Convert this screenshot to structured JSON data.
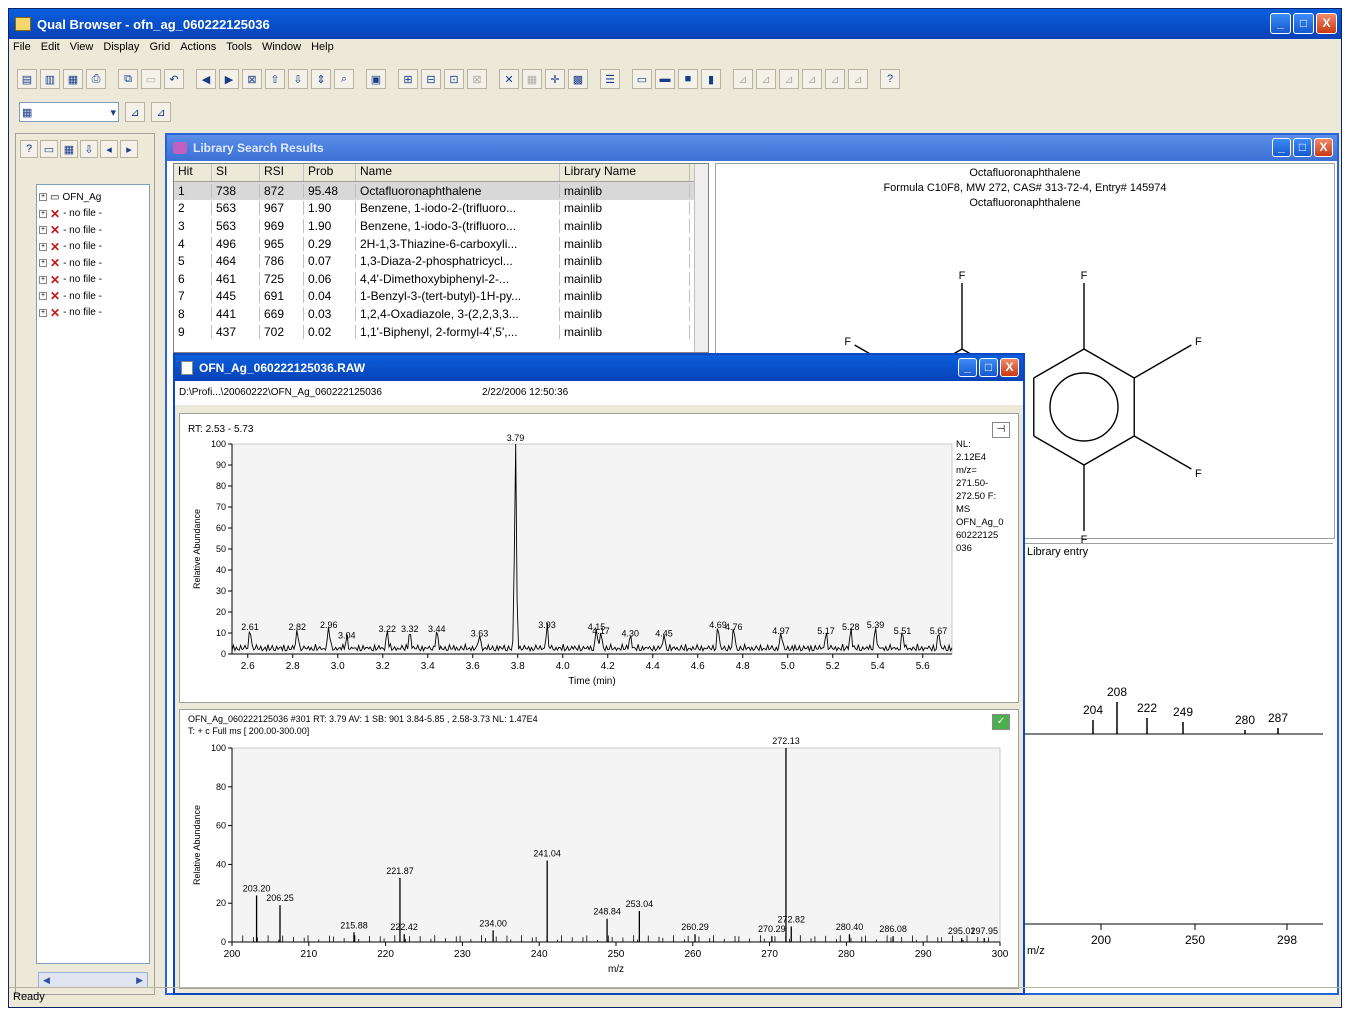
{
  "app": {
    "title": "Qual Browser - ofn_ag_060222125036",
    "minimize": "_",
    "maximize": "□",
    "close": "X",
    "status": "Ready"
  },
  "menu": [
    "File",
    "Edit",
    "View",
    "Display",
    "Grid",
    "Actions",
    "Tools",
    "Window",
    "Help"
  ],
  "toolbar2": {
    "combo_value": ""
  },
  "tree": {
    "items": [
      {
        "label": "OFN_Ag",
        "icon": "document-icon"
      },
      {
        "label": "- no file -",
        "icon": "error-x-icon"
      },
      {
        "label": "- no file -",
        "icon": "error-x-icon"
      },
      {
        "label": "- no file -",
        "icon": "error-x-icon"
      },
      {
        "label": "- no file -",
        "icon": "error-x-icon"
      },
      {
        "label": "- no file -",
        "icon": "error-x-icon"
      },
      {
        "label": "- no file -",
        "icon": "error-x-icon"
      },
      {
        "label": "- no file -",
        "icon": "error-x-icon"
      }
    ]
  },
  "library": {
    "title": "Library Search Results",
    "columns": [
      "Hit",
      "SI",
      "RSI",
      "Prob",
      "Name",
      "Library Name"
    ],
    "rows": [
      [
        "1",
        "738",
        "872",
        "95.48",
        "Octafluoronaphthalene",
        "mainlib"
      ],
      [
        "2",
        "563",
        "967",
        "1.90",
        "Benzene, 1-iodo-2-(trifluoro...",
        "mainlib"
      ],
      [
        "3",
        "563",
        "969",
        "1.90",
        "Benzene, 1-iodo-3-(trifluoro...",
        "mainlib"
      ],
      [
        "4",
        "496",
        "965",
        "0.29",
        "2H-1,3-Thiazine-6-carboxyli...",
        "mainlib"
      ],
      [
        "5",
        "464",
        "786",
        "0.07",
        "1,3-Diaza-2-phosphatricycl...",
        "mainlib"
      ],
      [
        "6",
        "461",
        "725",
        "0.06",
        "4,4'-Dimethoxybiphenyl-2-...",
        "mainlib"
      ],
      [
        "7",
        "445",
        "691",
        "0.04",
        "1-Benzyl-3-(tert-butyl)-1H-py...",
        "mainlib"
      ],
      [
        "8",
        "441",
        "669",
        "0.03",
        "1,2,4-Oxadiazole, 3-(2,2,3,3...",
        "mainlib"
      ],
      [
        "9",
        "437",
        "702",
        "0.02",
        "1,1'-Biphenyl, 2-formyl-4',5',...",
        "mainlib"
      ]
    ],
    "molecule": {
      "name": "Octafluoronaphthalene",
      "formula": "Formula C10F8, MW 272, CAS# 313-72-4, Entry# 145974",
      "name2": "Octafluoronaphthalene",
      "atom": "F"
    },
    "entry_label": "Library entry",
    "entry_peaks": [
      "204",
      "208",
      "222",
      "249",
      "280",
      "287"
    ],
    "entry_ticks": [
      "200",
      "250",
      "298"
    ],
    "entry_axis": "m/z"
  },
  "raw": {
    "title": "OFN_Ag_060222125036.RAW",
    "path": "D:\\Profi...\\20060222\\OFN_Ag_060222125036",
    "datetime": "2/22/2006 12:50:36",
    "chrom_header": "RT: 2.53 - 5.73",
    "chrom_side": [
      "NL:",
      "2.12E4",
      "m/z=",
      "271.50-",
      "272.50 F:",
      "MS",
      "OFN_Ag_0",
      "60222125",
      "036"
    ],
    "spec_header": "OFN_Ag_060222125036 #301   RT: 3.79   AV: 1   SB: 901 3.84-5.85 , 2.58-3.73   NL: 1.47E4",
    "spec_header2": "T: + c Full ms [ 200.00-300.00]"
  },
  "chart_data": [
    {
      "type": "line",
      "title": "",
      "xlabel": "Time (min)",
      "ylabel": "Relative Abundance",
      "xlim": [
        2.53,
        5.73
      ],
      "ylim": [
        0,
        100
      ],
      "xticks": [
        "2.6",
        "2.8",
        "3.0",
        "3.2",
        "3.4",
        "3.6",
        "3.8",
        "4.0",
        "4.2",
        "4.4",
        "4.6",
        "4.8",
        "5.0",
        "5.2",
        "5.4",
        "5.6"
      ],
      "yticks": [
        "0",
        "10",
        "20",
        "30",
        "40",
        "50",
        "60",
        "70",
        "80",
        "90",
        "100"
      ],
      "peaks": [
        {
          "x": 2.61,
          "y": 10,
          "label": "2.61"
        },
        {
          "x": 2.82,
          "y": 10,
          "label": "2.82"
        },
        {
          "x": 2.96,
          "y": 11,
          "label": "2.96"
        },
        {
          "x": 3.04,
          "y": 6,
          "label": "3.04"
        },
        {
          "x": 3.22,
          "y": 9,
          "label": "3.22"
        },
        {
          "x": 3.32,
          "y": 9,
          "label": "3.32"
        },
        {
          "x": 3.44,
          "y": 9,
          "label": "3.44"
        },
        {
          "x": 3.63,
          "y": 7,
          "label": "3.63"
        },
        {
          "x": 3.79,
          "y": 100,
          "label": "3.79"
        },
        {
          "x": 3.93,
          "y": 11,
          "label": "3.93"
        },
        {
          "x": 4.15,
          "y": 10,
          "label": "4.15"
        },
        {
          "x": 4.17,
          "y": 8,
          "label": "4.17"
        },
        {
          "x": 4.3,
          "y": 7,
          "label": "4.30"
        },
        {
          "x": 4.45,
          "y": 7,
          "label": "4.45"
        },
        {
          "x": 4.69,
          "y": 11,
          "label": "4.69"
        },
        {
          "x": 4.76,
          "y": 10,
          "label": "4.76"
        },
        {
          "x": 4.97,
          "y": 8,
          "label": "4.97"
        },
        {
          "x": 5.17,
          "y": 8,
          "label": "5.17"
        },
        {
          "x": 5.28,
          "y": 10,
          "label": "5.28"
        },
        {
          "x": 5.39,
          "y": 11,
          "label": "5.39"
        },
        {
          "x": 5.51,
          "y": 8,
          "label": "5.51"
        },
        {
          "x": 5.67,
          "y": 8,
          "label": "5.67"
        }
      ]
    },
    {
      "type": "bar",
      "title": "",
      "xlabel": "m/z",
      "ylabel": "Relative Abundance",
      "xlim": [
        200,
        300
      ],
      "ylim": [
        0,
        100
      ],
      "xticks": [
        "200",
        "210",
        "220",
        "230",
        "240",
        "250",
        "260",
        "270",
        "280",
        "290",
        "300"
      ],
      "yticks": [
        "0",
        "20",
        "40",
        "60",
        "80",
        "100"
      ],
      "peaks": [
        {
          "x": 203.2,
          "y": 24,
          "label": "203.20"
        },
        {
          "x": 206.25,
          "y": 19,
          "label": "206.25"
        },
        {
          "x": 215.88,
          "y": 5,
          "label": "215.88"
        },
        {
          "x": 221.87,
          "y": 33,
          "label": "221.87"
        },
        {
          "x": 222.42,
          "y": 4,
          "label": "222.42"
        },
        {
          "x": 234.0,
          "y": 6,
          "label": "234.00"
        },
        {
          "x": 241.04,
          "y": 42,
          "label": "241.04"
        },
        {
          "x": 248.84,
          "y": 12,
          "label": "248.84"
        },
        {
          "x": 253.04,
          "y": 16,
          "label": "253.04"
        },
        {
          "x": 260.29,
          "y": 4,
          "label": "260.29"
        },
        {
          "x": 270.29,
          "y": 3,
          "label": "270.29"
        },
        {
          "x": 272.13,
          "y": 100,
          "label": "272.13"
        },
        {
          "x": 272.82,
          "y": 8,
          "label": "272.82"
        },
        {
          "x": 280.4,
          "y": 4,
          "label": "280.40"
        },
        {
          "x": 286.08,
          "y": 3,
          "label": "286.08"
        },
        {
          "x": 295.01,
          "y": 2,
          "label": "295.01"
        },
        {
          "x": 297.95,
          "y": 2,
          "label": "297.95"
        }
      ]
    }
  ]
}
